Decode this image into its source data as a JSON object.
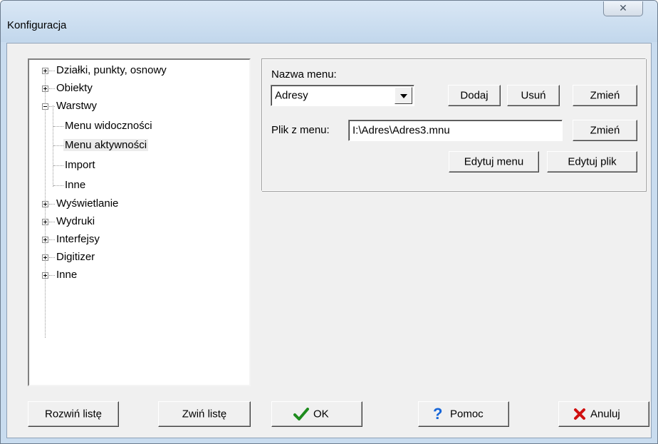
{
  "window": {
    "title": "Konfiguracja",
    "close_glyph": "✕"
  },
  "tree": {
    "items": [
      {
        "label": "Działki, punkty, osnowy",
        "expander": "plus"
      },
      {
        "label": "Obiekty",
        "expander": "plus"
      },
      {
        "label": "Warstwy",
        "expander": "minus"
      },
      {
        "label": "Menu widoczności",
        "expander": "none"
      },
      {
        "label": "Menu aktywności",
        "expander": "none",
        "selected": true
      },
      {
        "label": "Import",
        "expander": "none"
      },
      {
        "label": "Inne",
        "expander": "none"
      },
      {
        "label": "Wyświetlanie",
        "expander": "plus"
      },
      {
        "label": "Wydruki",
        "expander": "plus"
      },
      {
        "label": "Interfejsy",
        "expander": "plus"
      },
      {
        "label": "Digitizer",
        "expander": "plus"
      },
      {
        "label": "Inne",
        "expander": "plus"
      }
    ]
  },
  "panel": {
    "menu_name_label": "Nazwa menu:",
    "menu_name_value": "Adresy",
    "add_label": "Dodaj",
    "remove_label": "Usuń",
    "change_label": "Zmień",
    "file_label": "Plik z menu:",
    "file_value": "I:\\Adres\\Adres3.mnu",
    "file_change_label": "Zmień",
    "edit_menu_label": "Edytuj menu",
    "edit_file_label": "Edytuj plik"
  },
  "footer": {
    "expand_label": "Rozwiń listę",
    "collapse_label": "Zwiń listę",
    "ok_label": "OK",
    "help_label": "Pomoc",
    "cancel_label": "Anuluj"
  },
  "colors": {
    "ok_check": "#1e8c1e",
    "help_mark": "#1565d8",
    "cancel_x": "#d01010"
  }
}
